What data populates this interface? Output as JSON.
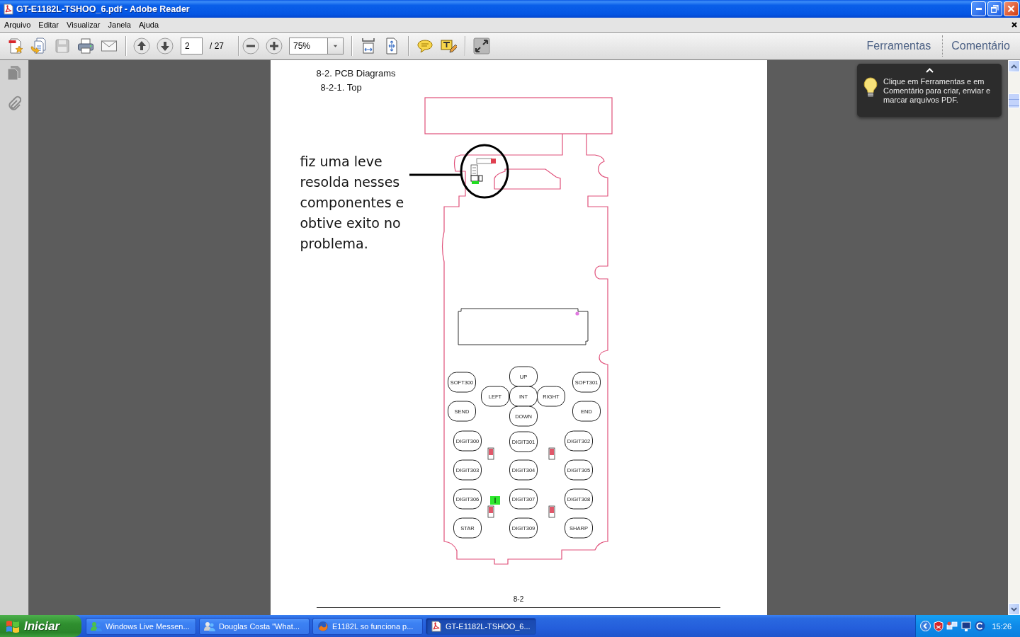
{
  "window": {
    "title": "GT-E1182L-TSHOO_6.pdf - Adobe Reader"
  },
  "menu_bar": {
    "items": [
      "Arquivo",
      "Editar",
      "Visualizar",
      "Janela",
      "Ajuda"
    ]
  },
  "toolbar": {
    "save_button": {
      "disabled": true
    },
    "page_field": {
      "value": "2"
    },
    "page_total": "/ 27",
    "zoom_field": {
      "value": "75%"
    },
    "panel_buttons": [
      "Ferramentas",
      "Comentário"
    ]
  },
  "tip": {
    "text": "Clique em Ferramentas e em Comentário para criar, enviar e marcar arquivos PDF."
  },
  "document": {
    "heading": "8-2. PCB Diagrams",
    "subheading": "8-2-1. Top",
    "note": "fiz uma leve resolda nesses componentes e obtive exito no problema.",
    "keys": [
      "SOFT300",
      "UP",
      "SOFT301",
      "LEFT",
      "INT",
      "RIGHT",
      "SEND",
      "DOWN",
      "END",
      "DIGIT300",
      "DIGIT301",
      "DIGIT302",
      "DIGIT303",
      "DIGIT304",
      "DIGIT305",
      "DIGIT306",
      "DIGIT307",
      "DIGIT308",
      "STAR",
      "DIGIT309",
      "SHARP"
    ],
    "page_number": "8-2"
  },
  "taskbar": {
    "start_button": "Iniciar",
    "tasks": [
      {
        "kind": "messenger",
        "label": "Windows Live Messen...",
        "selected": false
      },
      {
        "kind": "chat",
        "label": "Douglas Costa \"What...",
        "selected": false
      },
      {
        "kind": "browser",
        "label": "E1182L so funciona p...",
        "selected": false
      },
      {
        "kind": "pdf",
        "label": "GT-E1182L-TSHOO_6...",
        "selected": true
      }
    ],
    "clock": "15:26"
  }
}
